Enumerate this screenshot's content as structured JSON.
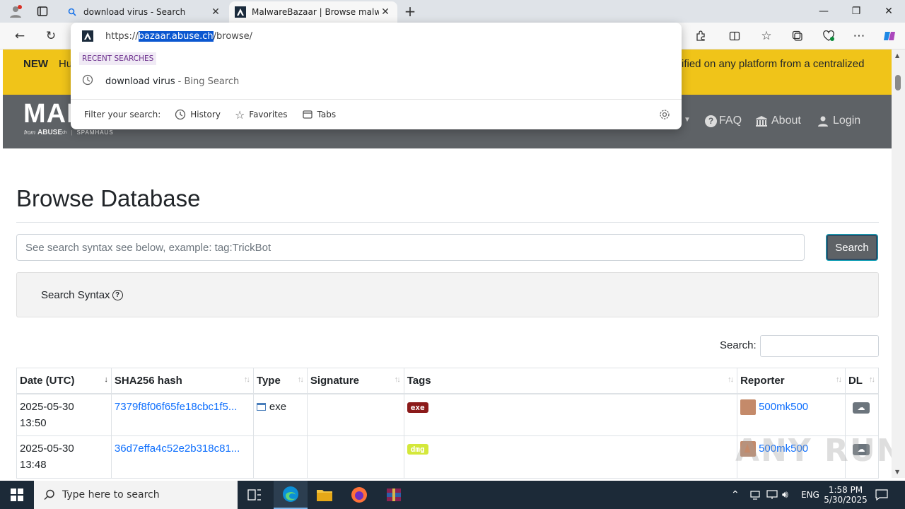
{
  "browser": {
    "tabs": [
      {
        "title": "download virus - Search",
        "active": false,
        "icon": "search-icon"
      },
      {
        "title": "MalwareBazaar | Browse malware",
        "active": true,
        "icon": "malwarebazaar-favicon"
      }
    ],
    "new_tab": "+",
    "window_controls": {
      "minimize": "—",
      "restore": "❐",
      "close": "✕"
    }
  },
  "omnibox": {
    "url_prefix": "https://",
    "url_host": "bazaar.abuse.ch",
    "url_path": "/browse/",
    "recent_label": "RECENT SEARCHES",
    "recent_item": "download virus",
    "recent_item_suffix": " - Bing Search",
    "filter_label": "Filter your search:",
    "filters": [
      "History",
      "Favorites",
      "Tabs"
    ]
  },
  "banner": {
    "new_label": "NEW",
    "left_text": "Hu",
    "right_text": "ified on any platform from a centralized"
  },
  "site_nav": {
    "logo": "MAL",
    "from_label": "from",
    "abuse_label": "ABUSE",
    "abuse_sup": "ch",
    "spamhaus_label": "SPAMHAUS",
    "faq": "FAQ",
    "about": "About",
    "login": "Login"
  },
  "page": {
    "title": "Browse Database",
    "search_placeholder": "See search syntax see below, example: tag:TrickBot",
    "search_button": "Search",
    "syntax_label": "Search Syntax",
    "table_search_label": "Search:"
  },
  "table": {
    "columns": [
      "Date (UTC)",
      "SHA256 hash",
      "Type",
      "Signature",
      "Tags",
      "Reporter",
      "DL"
    ],
    "rows": [
      {
        "date": "2025-05-30",
        "time": "13:50",
        "hash": "7379f8f06f65fe18cbc1f5...",
        "type": "exe",
        "signature": "",
        "tag": "exe",
        "reporter": "500mk500"
      },
      {
        "date": "2025-05-30",
        "time": "13:48",
        "hash": "36d7effa4c52e2b318c81...",
        "type": "",
        "signature": "",
        "tag": "dmg",
        "reporter": "500mk500"
      }
    ]
  },
  "taskbar": {
    "search_placeholder": "Type here to search",
    "lang": "ENG",
    "time": "1:58 PM",
    "date": "5/30/2025"
  },
  "watermark": "ANY RUN"
}
